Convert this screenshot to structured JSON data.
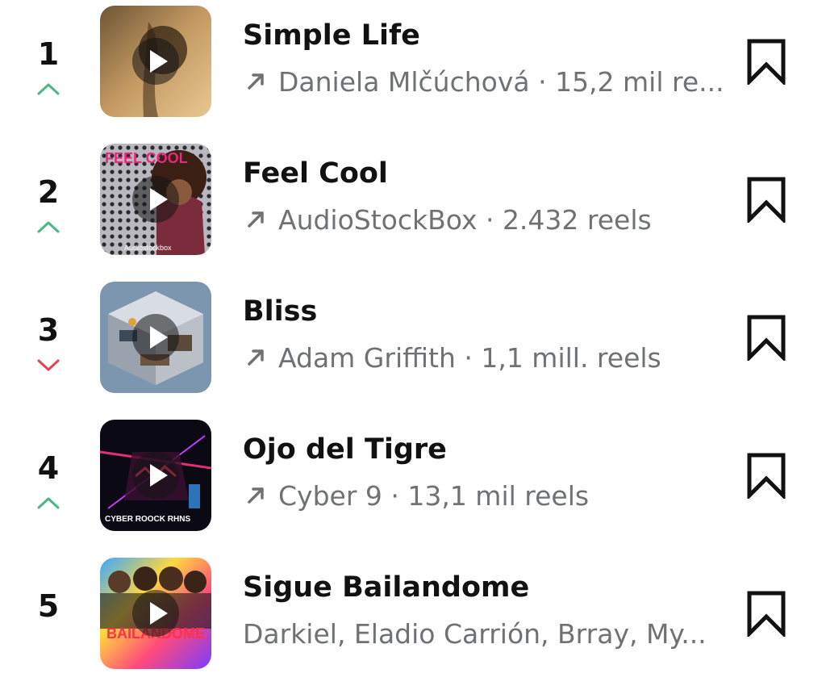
{
  "tracks": [
    {
      "rank": "1",
      "trend": "up",
      "title": "Simple Life",
      "subtitle": "Daniela Mlčúchová · 15,2 mil re...",
      "trending_icon": "trending-arrow-icon"
    },
    {
      "rank": "2",
      "trend": "up",
      "title": "Feel Cool",
      "subtitle": "AudioStockBox · 2.432 reels",
      "trending_icon": "trending-arrow-icon"
    },
    {
      "rank": "3",
      "trend": "down",
      "title": "Bliss",
      "subtitle": "Adam Griffith · 1,1 mill. reels",
      "trending_icon": "trending-arrow-icon"
    },
    {
      "rank": "4",
      "trend": "up",
      "title": "Ojo del Tigre",
      "subtitle": "Cyber 9 · 13,1 mil reels",
      "trending_icon": "trending-arrow-icon"
    },
    {
      "rank": "5",
      "trend": "none",
      "title": "Sigue Bailandome",
      "subtitle": "Darkiel, Eladio Carrión, Brray, My...",
      "trending_icon": ""
    }
  ],
  "cover_labels": {
    "feel_cool_badge": "FEEL COOL",
    "feel_cool_brand": "Audiostockbox",
    "ojo_brand": "CYBER ROOCK RHNS",
    "sigue_text": "BAILANDOME"
  },
  "colors": {
    "trend_up": "#4cb782",
    "trend_down": "#e0474c",
    "subtitle": "#6f7175",
    "title": "#111111"
  }
}
